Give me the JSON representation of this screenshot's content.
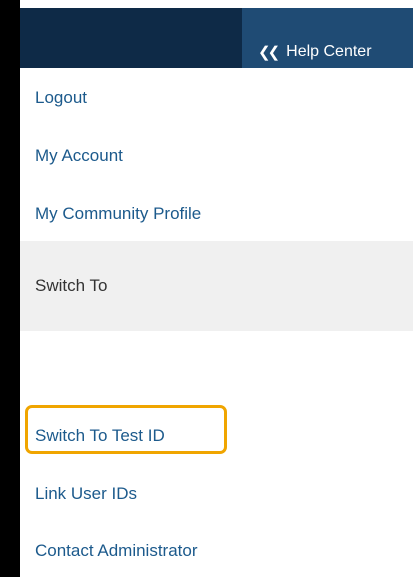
{
  "header": {
    "help_center_label": "Help Center",
    "help_center_icon": "double-chevron-left-icon"
  },
  "menu": {
    "logout": "Logout",
    "my_account": "My Account",
    "my_community_profile": "My Community Profile",
    "switch_to": "Switch To",
    "switch_to_test_id": "Switch To Test ID",
    "link_user_ids": "Link User IDs",
    "contact_administrator": "Contact Administrator"
  },
  "colors": {
    "header_dark": "#0e2a47",
    "header_blue": "#1f4b74",
    "link": "#1c5a8c",
    "highlight": "#f0a500",
    "section_bg": "#f0f0f0"
  }
}
